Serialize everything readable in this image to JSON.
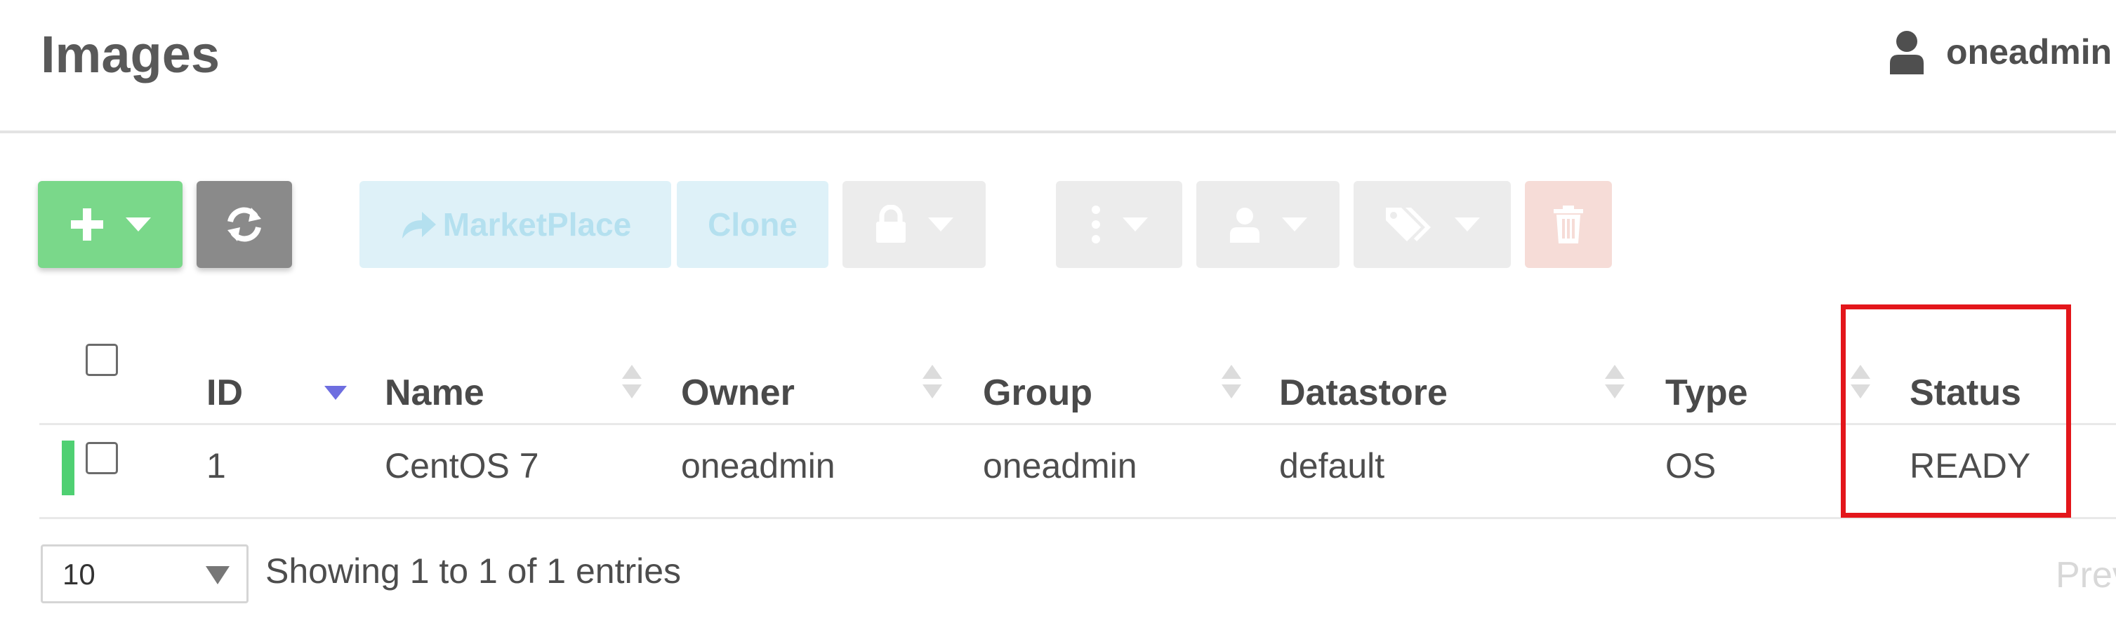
{
  "header": {
    "title": "Images",
    "user_name": "oneadmin"
  },
  "toolbar": {
    "marketplace_label": "MarketPlace",
    "clone_label": "Clone"
  },
  "table": {
    "columns": [
      "ID",
      "Name",
      "Owner",
      "Group",
      "Datastore",
      "Type",
      "Status"
    ],
    "sorted_column": "ID",
    "rows": [
      {
        "id": "1",
        "name": "CentOS 7",
        "owner": "oneadmin",
        "group": "oneadmin",
        "datastore": "default",
        "type": "OS",
        "status": "READY"
      }
    ]
  },
  "footer": {
    "page_length": "10",
    "entries_info": "Showing 1 to 1 of 1 entries",
    "prev_label": "Prev"
  },
  "colors": {
    "create": "#7ad88a",
    "refresh": "#8a8a8a",
    "marketplace": "#def1f8",
    "delete": "#f6dcd7",
    "status_ready": "#4fd072",
    "highlight": "#e3161b",
    "sort_active": "#6e6ee0"
  },
  "icons": {
    "create": "plus-icon",
    "refresh": "refresh-icon",
    "marketplace": "share-icon",
    "lock": "lock-icon",
    "more": "vertical-ellipsis-icon",
    "owner": "user-icon",
    "labels": "tags-icon",
    "delete": "trash-icon"
  }
}
